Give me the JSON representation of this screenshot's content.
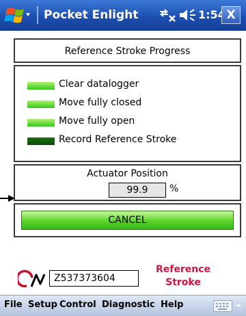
{
  "titlebar": {
    "title": "Pocket Enlight",
    "clock": "1:54",
    "close_label": "X"
  },
  "header": {
    "title": "Reference Stroke Progress"
  },
  "steps": [
    {
      "label": "Clear datalogger",
      "status": "complete"
    },
    {
      "label": "Move fully closed",
      "status": "complete"
    },
    {
      "label": "Move fully open",
      "status": "complete"
    },
    {
      "label": "Record Reference Stroke",
      "status": "in-progress"
    }
  ],
  "position": {
    "title": "Actuator Position",
    "value": "99.9",
    "unit": "%"
  },
  "cancel": {
    "label": "CANCEL"
  },
  "footer": {
    "serial": "Z537373604",
    "mode_line1": "Reference",
    "mode_line2": "Stroke"
  },
  "menubar": {
    "items": [
      "File",
      "Setup",
      "Control",
      "Diagnostic",
      "Help"
    ]
  },
  "colors": {
    "titlebar": "#1c4fb0",
    "step_complete": "#34c81c",
    "step_pending": "#0d4a08",
    "mode_text": "#d4143c",
    "cancel_button": "#59d52a"
  }
}
